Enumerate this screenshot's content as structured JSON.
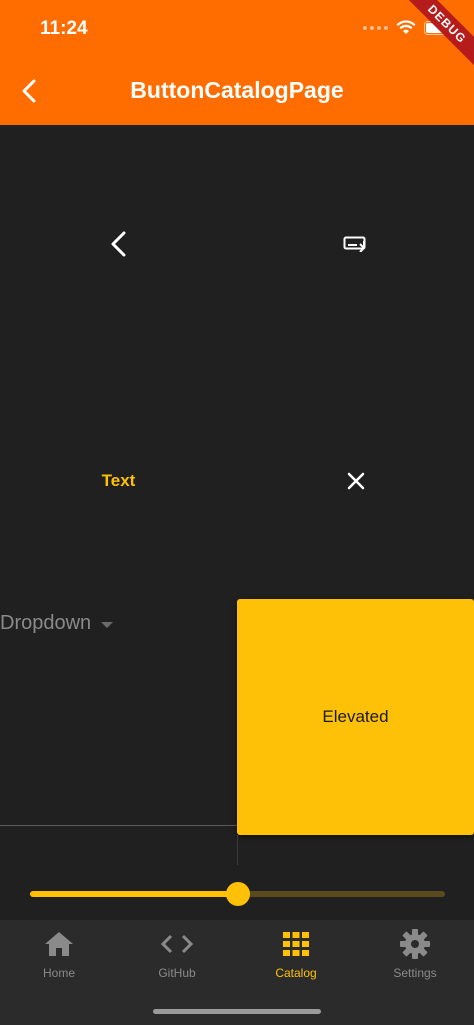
{
  "status_bar": {
    "time": "11:24"
  },
  "debug_banner": {
    "label": "DEBUG"
  },
  "app_bar": {
    "title": "ButtonCatalogPage",
    "color": "#FF6D00"
  },
  "buttons": {
    "icon_back": "chevron-left-icon",
    "icon_input": "keyboard-input-icon",
    "text_button_label": "Text",
    "icon_close": "close-icon",
    "dropdown_label": "Dropdown",
    "elevated_label": "Elevated"
  },
  "slider": {
    "value": 0.5
  },
  "bottom_nav": {
    "items": [
      {
        "label": "Home",
        "icon": "home-icon",
        "active": false
      },
      {
        "label": "GitHub",
        "icon": "code-icon",
        "active": false
      },
      {
        "label": "Catalog",
        "icon": "grid-icon",
        "active": true
      },
      {
        "label": "Settings",
        "icon": "gear-icon",
        "active": false
      }
    ],
    "active_color": "#FFC107",
    "inactive_color": "#8a8a8a"
  },
  "colors": {
    "accent": "#FFC107",
    "background": "#202020"
  }
}
